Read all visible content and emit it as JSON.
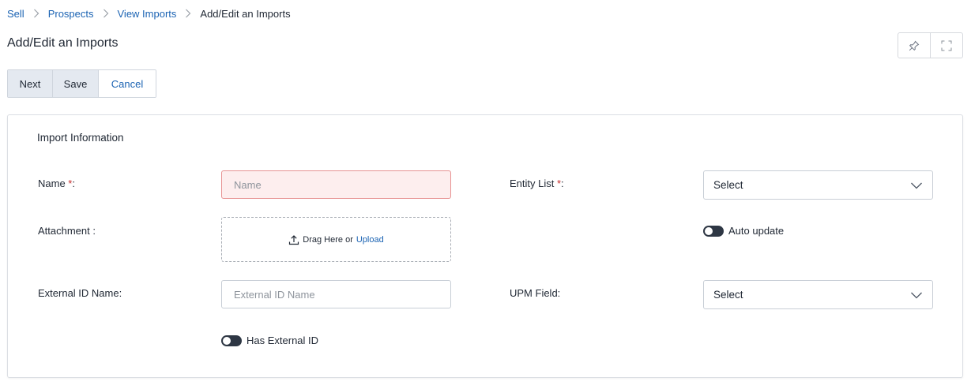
{
  "breadcrumb": {
    "items": [
      "Sell",
      "Prospects",
      "View Imports"
    ],
    "current": "Add/Edit an Imports"
  },
  "page": {
    "title": "Add/Edit an Imports"
  },
  "toolbar": {
    "pin_icon": "pin-icon",
    "fullscreen_icon": "fullscreen-icon"
  },
  "actions": {
    "next": "Next",
    "save": "Save",
    "cancel": "Cancel"
  },
  "form": {
    "section_title": "Import Information",
    "name": {
      "label": "Name ",
      "required": "*",
      "suffix": ":",
      "placeholder": "Name",
      "value": ""
    },
    "attachment": {
      "label": "Attachment :",
      "drag_text": "Drag Here or",
      "upload_text": "Upload"
    },
    "external_id_name": {
      "label": "External ID Name:",
      "placeholder": "External ID Name",
      "value": ""
    },
    "has_external_id": {
      "label": "Has External ID",
      "checked": false
    },
    "entity_list": {
      "label": "Entity List ",
      "required": "*",
      "suffix": ":",
      "selected": "Select"
    },
    "auto_update": {
      "label": "Auto update",
      "checked": false
    },
    "upm_field": {
      "label": "UPM Field:",
      "selected": "Select"
    }
  },
  "colors": {
    "link": "#1b63b3",
    "required": "#c52a2a",
    "toggle": "#2e3744",
    "error_bg": "#fdeeee",
    "error_border": "#e79393"
  }
}
